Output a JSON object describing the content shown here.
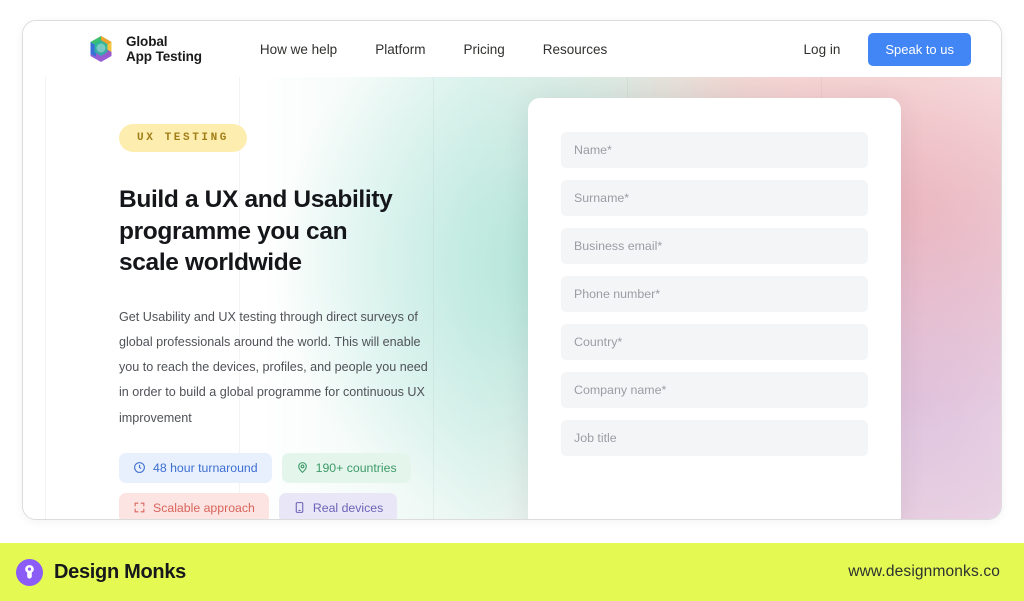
{
  "browser": {
    "header": {
      "logo_icon": "global-app-testing-hexagon-logo",
      "brand_name": "Global\nApp Testing",
      "nav_items": [
        {
          "label": "How we help"
        },
        {
          "label": "Platform"
        },
        {
          "label": "Pricing"
        },
        {
          "label": "Resources"
        }
      ],
      "login_label": "Log in",
      "cta_label": "Speak to us",
      "cta_color": "#4285f4"
    },
    "hero": {
      "eyebrow": "UX TESTING",
      "eyebrow_bg": "#fdeeb0",
      "eyebrow_color": "#a07d16",
      "title": "Build a UX and Usability programme you can scale worldwide",
      "description": "Get Usability and UX testing through direct surveys of global professionals around the world. This will enable you to reach the devices, profiles, and people you need in order to build a global programme for continuous UX improvement",
      "chips": [
        {
          "label": "48 hour turnaround",
          "icon": "clock-icon",
          "bg": "#e8f0fd",
          "color": "#3c6fd1"
        },
        {
          "label": "190+ countries",
          "icon": "location-pin-icon",
          "bg": "#e4f6ec",
          "color": "#3d9a68"
        },
        {
          "label": "Scalable approach",
          "icon": "expand-arrows-icon",
          "bg": "#fbe4e1",
          "color": "#d9645c"
        },
        {
          "label": "Real devices",
          "icon": "mobile-device-icon",
          "bg": "#e9e7f7",
          "color": "#6d62b8"
        }
      ]
    },
    "form": {
      "fields": [
        {
          "name": "name",
          "placeholder": "Name*",
          "value": ""
        },
        {
          "name": "surname",
          "placeholder": "Surname*",
          "value": ""
        },
        {
          "name": "business-email",
          "placeholder": "Business email*",
          "value": ""
        },
        {
          "name": "phone-number",
          "placeholder": "Phone number*",
          "value": ""
        },
        {
          "name": "country",
          "placeholder": "Country*",
          "value": ""
        },
        {
          "name": "company-name",
          "placeholder": "Company name*",
          "value": ""
        },
        {
          "name": "job-title",
          "placeholder": "Job title",
          "value": ""
        }
      ]
    }
  },
  "footer": {
    "logo_icon": "design-monks-circular-logo",
    "brand_name": "Design Monks",
    "url": "www.designmonks.co",
    "bg_color": "#e4fa52"
  }
}
